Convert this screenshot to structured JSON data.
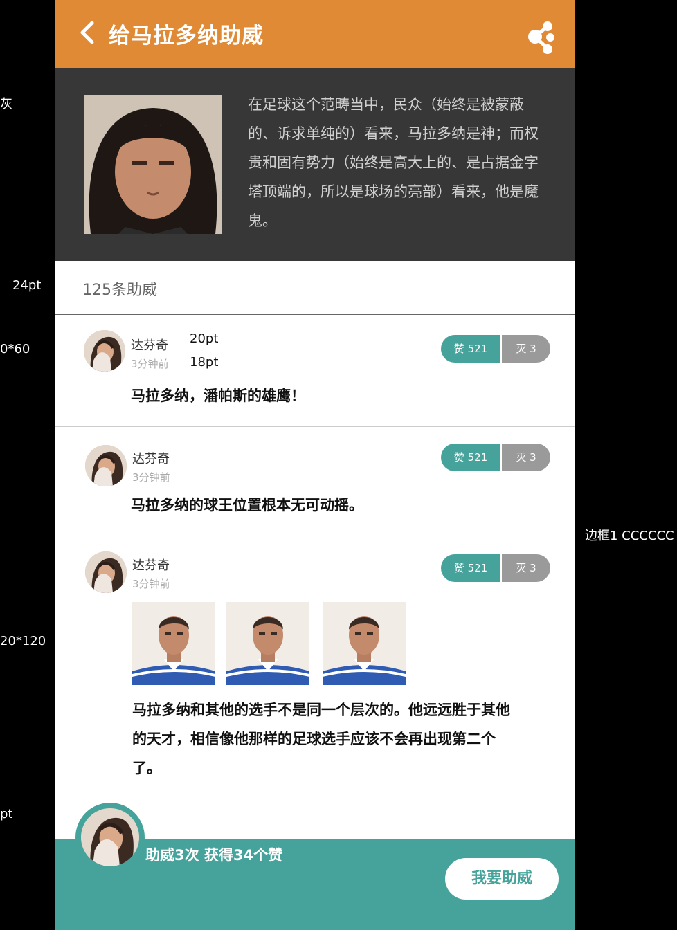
{
  "header": {
    "title": "给马拉多纳助威"
  },
  "intro": {
    "text": "在足球这个范畴当中，民众（始终是被蒙蔽的、诉求单纯的）看来，马拉多纳是神；而权贵和固有势力（始终是高大上的、是占据金字塔顶端的，所以是球场的亮部）看来，他是魔鬼。"
  },
  "count_label": "125条助威",
  "comments": [
    {
      "user": "达芬奇",
      "time": "3分钟前",
      "text": "马拉多纳，潘帕斯的雄鹰！",
      "like": "赞 521",
      "dislike": "灭 3"
    },
    {
      "user": "达芬奇",
      "time": "3分钟前",
      "text": "马拉多纳的球王位置根本无可动摇。",
      "like": "赞 521",
      "dislike": "灭 3"
    },
    {
      "user": "达芬奇",
      "time": "3分钟前",
      "text": "马拉多纳和其他的选手不是同一个层次的。他远远胜于其他的天才，相信像他那样的足球选手应该不会再出现第二个了。",
      "like": "赞 521",
      "dislike": "灭 3"
    }
  ],
  "annotations": {
    "name_size": "20pt",
    "time_size": "18pt"
  },
  "footer": {
    "stats": "助威3次  获得34个赞",
    "button": "我要助威"
  },
  "side_notes": {
    "gray": "灰",
    "pt24": "24pt",
    "avatar_size": "0*60",
    "border": "边框1 CCCCCC",
    "thumb_size": "20*120",
    "pt": "pt"
  },
  "colors": {
    "header": "#e08a35",
    "intro_bg": "#373737",
    "accent": "#45a39b",
    "dislike": "#9a9a9a",
    "border": "#cccccc"
  }
}
